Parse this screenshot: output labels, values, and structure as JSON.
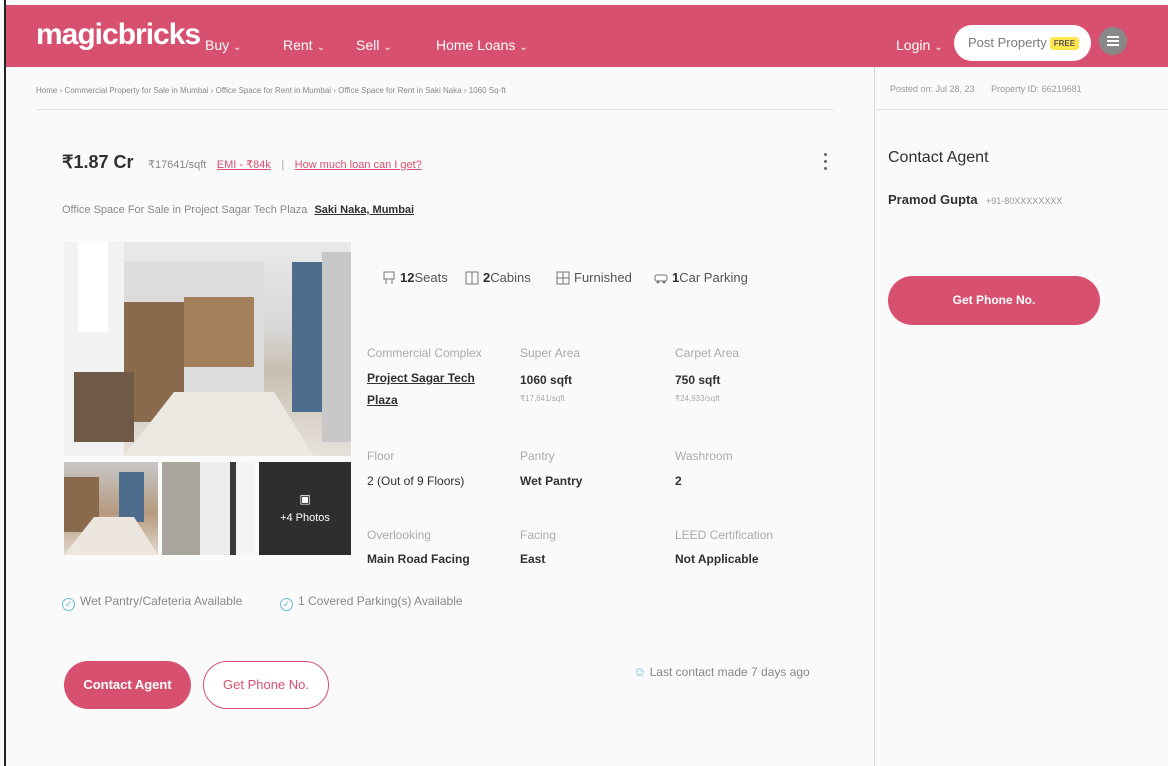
{
  "header": {
    "logo": "magicbricks",
    "nav": [
      {
        "label": "Buy"
      },
      {
        "label": "Rent"
      },
      {
        "label": "Sell"
      },
      {
        "label": "Home Loans"
      }
    ],
    "login": "Login",
    "post_property": "Post Property",
    "free_tag": "FREE",
    "colors": {
      "brand": "#d8506f"
    }
  },
  "breadcrumb": "Home › Commercial Property for Sale in Mumbai › Office Space for Rent in Mumbai › Office Space for Rent in Saki Naka › 1060 Sq-ft",
  "posted": {
    "date_text": "Posted on: Jul 28, 23",
    "property_id": "Property ID: 66219681"
  },
  "listing": {
    "price": "₹1.87 Cr",
    "price_per_sqft": "₹17641/sqft",
    "emi": "EMI - ₹84k",
    "separator": "|",
    "loan_link": "How much loan can I get?",
    "subtitle": "Office Space For Sale in Project Sagar Tech Plaza",
    "location": "Saki Naka, Mumbai",
    "photos_more": "+4 Photos",
    "highlights": [
      {
        "value": "12",
        "label": "Seats",
        "icon": "seat-icon"
      },
      {
        "value": "2",
        "label": "Cabins",
        "icon": "cabin-icon"
      },
      {
        "value": "",
        "label": "Furnished",
        "icon": "furnished-icon"
      },
      {
        "value": "1",
        "label": "Car Parking",
        "icon": "parking-icon"
      }
    ],
    "specs": [
      {
        "label": "Commercial Complex",
        "value": "Project Sagar Tech Plaza"
      },
      {
        "label": "Super Area",
        "value": "1060 sqft",
        "sub": "₹17,641/sqft"
      },
      {
        "label": "Carpet Area",
        "value": "750 sqft",
        "sub": "₹24,933/sqft"
      },
      {
        "label": "Floor",
        "value": "2 (Out of 9 Floors)"
      },
      {
        "label": "Pantry",
        "value": "Wet Pantry"
      },
      {
        "label": "Washroom",
        "value": "2"
      },
      {
        "label": "Overlooking",
        "value": "Main Road Facing"
      },
      {
        "label": "Facing",
        "value": "East"
      },
      {
        "label": "LEED Certification",
        "value": "Not Applicable"
      }
    ],
    "amenities": [
      "Wet Pantry/Cafeteria Available",
      "1 Covered Parking(s) Available"
    ],
    "contact_button": "Contact Agent",
    "phone_button": "Get Phone No.",
    "last_contact": "Last contact made 7 days ago"
  },
  "sidebar": {
    "title": "Contact Agent",
    "agent_name": "Pramod Gupta",
    "agent_phone": "+91-80XXXXXXXX",
    "phone_button": "Get Phone No."
  }
}
